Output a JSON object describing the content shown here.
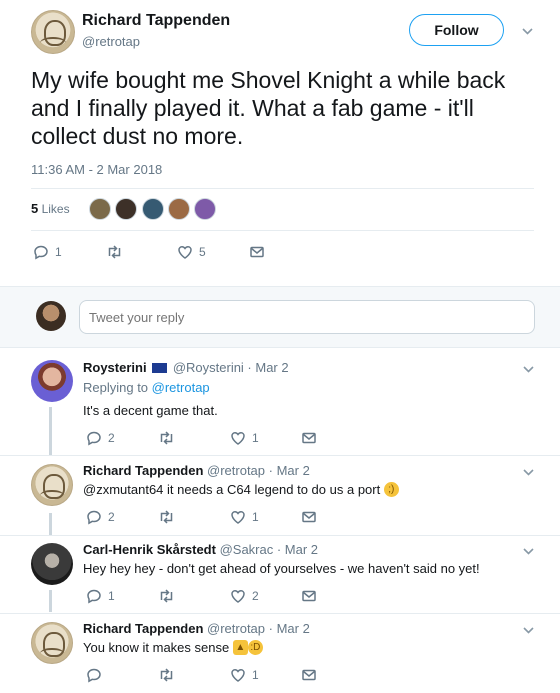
{
  "main_tweet": {
    "author_name": "Richard Tappenden",
    "author_handle": "@retrotap",
    "follow_label": "Follow",
    "text": "My wife bought me Shovel Knight a while back and I finally played it. What a fab game - it'll collect dust no more.",
    "timestamp": "11:36 AM - 2 Mar 2018",
    "likes_number": "5",
    "likes_label": "Likes",
    "reply_count": "1",
    "retweet_count": "",
    "like_count": "5"
  },
  "reply_box": {
    "placeholder": "Tweet your reply"
  },
  "replies": [
    {
      "name": "Roysterini",
      "meta": "@Roysterini · Mar 2",
      "replying_prefix": "Replying to ",
      "replying_to": "@retrotap",
      "text": "It's a decent game that.",
      "reply_count": "2",
      "like_count": "1"
    },
    {
      "name": "Richard Tappenden",
      "meta": "@retrotap · Mar 2",
      "text": "@zxmutant64 it needs a C64 legend to do us a port",
      "reply_count": "2",
      "like_count": "1"
    },
    {
      "name": "Carl-Henrik Skårstedt",
      "meta": "@Sakrac · Mar 2",
      "text": "Hey hey hey - don't get ahead of yourselves - we haven't said no yet!",
      "reply_count": "1",
      "like_count": "2"
    },
    {
      "name": "Richard Tappenden",
      "meta": "@retrotap · Mar 2",
      "text": "You know it makes sense",
      "reply_count": "",
      "like_count": "1"
    }
  ],
  "icons": [
    "reply-icon",
    "retweet-icon",
    "like-icon",
    "message-icon",
    "chevron-down-icon",
    "eu-flag-icon",
    "wink-emoji-icon",
    "thumbs-up-emoji-icon",
    "grin-emoji-icon"
  ],
  "colors": {
    "accent": "#1da1f2",
    "muted": "#657786",
    "divider": "#e6ecf0"
  }
}
